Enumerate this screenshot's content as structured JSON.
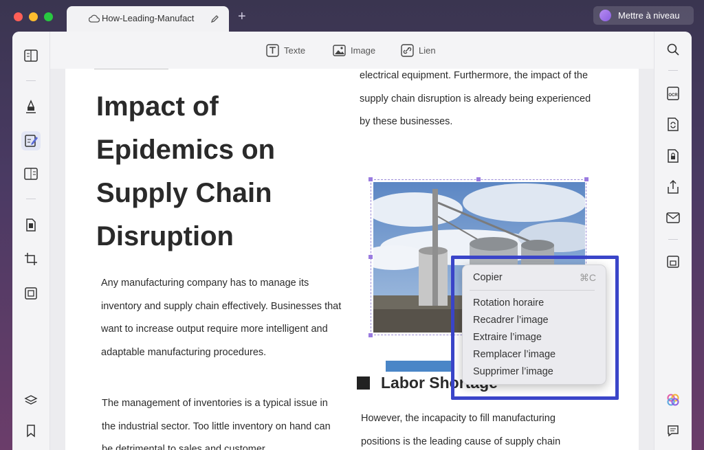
{
  "window": {
    "tab_title": "How-Leading-Manufact",
    "upgrade_label": "Mettre à niveau"
  },
  "toolbar": {
    "text_label": "Texte",
    "image_label": "Image",
    "link_label": "Lien"
  },
  "document": {
    "title": "Impact of Epidemics on Supply Chain Disruption",
    "paragraph_1": "Any manufacturing company has to manage its inventory and supply chain effectively. Businesses that want to increase output require more intelligent and adaptable manufacturing procedures.",
    "paragraph_2": "The management of inventories is a typical issue in the industrial sector. Too little inventory on hand can be detrimental to sales and customer",
    "right_paragraph_1": "electrical equipment. Furthermore, the impact of the supply chain disruption is already being experienced by these businesses.",
    "section_heading": "Labor Shortage",
    "right_paragraph_2": "However, the incapacity to fill manufacturing positions is the leading cause of supply chain"
  },
  "context_menu": {
    "copy_label": "Copier",
    "copy_shortcut": "⌘C",
    "items": [
      "Rotation horaire",
      "Recadrer l’image",
      "Extraire l’image",
      "Remplacer l’image",
      "Supprimer l’image"
    ]
  },
  "colors": {
    "highlight_box": "#3a45c9",
    "accent": "#5b6bd6"
  }
}
